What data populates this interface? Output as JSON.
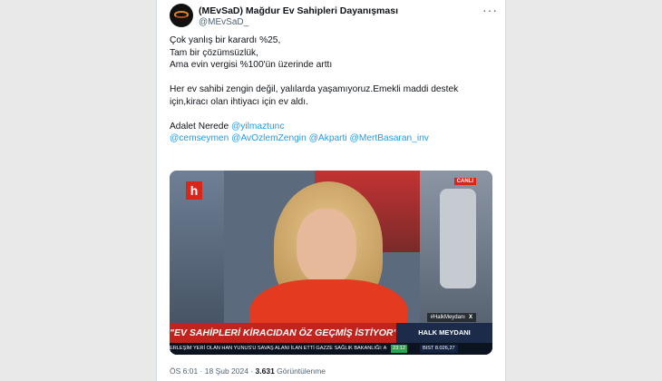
{
  "tweet": {
    "author_name": "(MEvSaD) Mağdur Ev Sahipleri Dayanışması",
    "author_handle": "@MEvSaD_",
    "more_icon": "···",
    "lines": {
      "l1": "Çok yanlış bir karardı %25,",
      "l2": "Tam bir çözümsüzlük,",
      "l3": "Ama evin vergisi %100'ün üzerinde arttı",
      "l4": "Her ev sahibi zengin değil, yalılarda yaşamıyoruz.Emekli maddi destek",
      "l5": "için,kiracı olan ihtiyacı için ev aldı.",
      "l6_prefix": "Adalet Nerede ",
      "mention1": "@yilmaztunc",
      "mention2": "@cemseymen",
      "mention3": "@AvOzlemZengin",
      "mention4": "@Akparti",
      "mention5": "@MertBasaran_inv"
    },
    "meta": {
      "time": "ÖS 6:01",
      "sep1": " · ",
      "date": "18 Şub 2024",
      "sep2": " · ",
      "views": "3.631",
      "views_label": " Görüntülenme"
    }
  },
  "video": {
    "channel_logo": "h",
    "live_label": "CANLI",
    "hashtag": "#HalkMeydanı",
    "x_mark": "X",
    "headline": "\"EV SAHİPLERİ KİRACIDAN ÖZ GEÇMİŞ İSTİYOR\"",
    "program": "HALK MEYDANI",
    "ticker_text": "ERLEŞİM YERİ OLAN HAN YUNUS'U SAVAŞ ALANI İLAN ETTİ   GAZZE SAĞLIK BAKANLIĞI: A",
    "ticker_time": "23:12",
    "bist": "BIST 8.026,27"
  },
  "colors": {
    "link": "#1d9bf0",
    "red": "#d8261b"
  }
}
